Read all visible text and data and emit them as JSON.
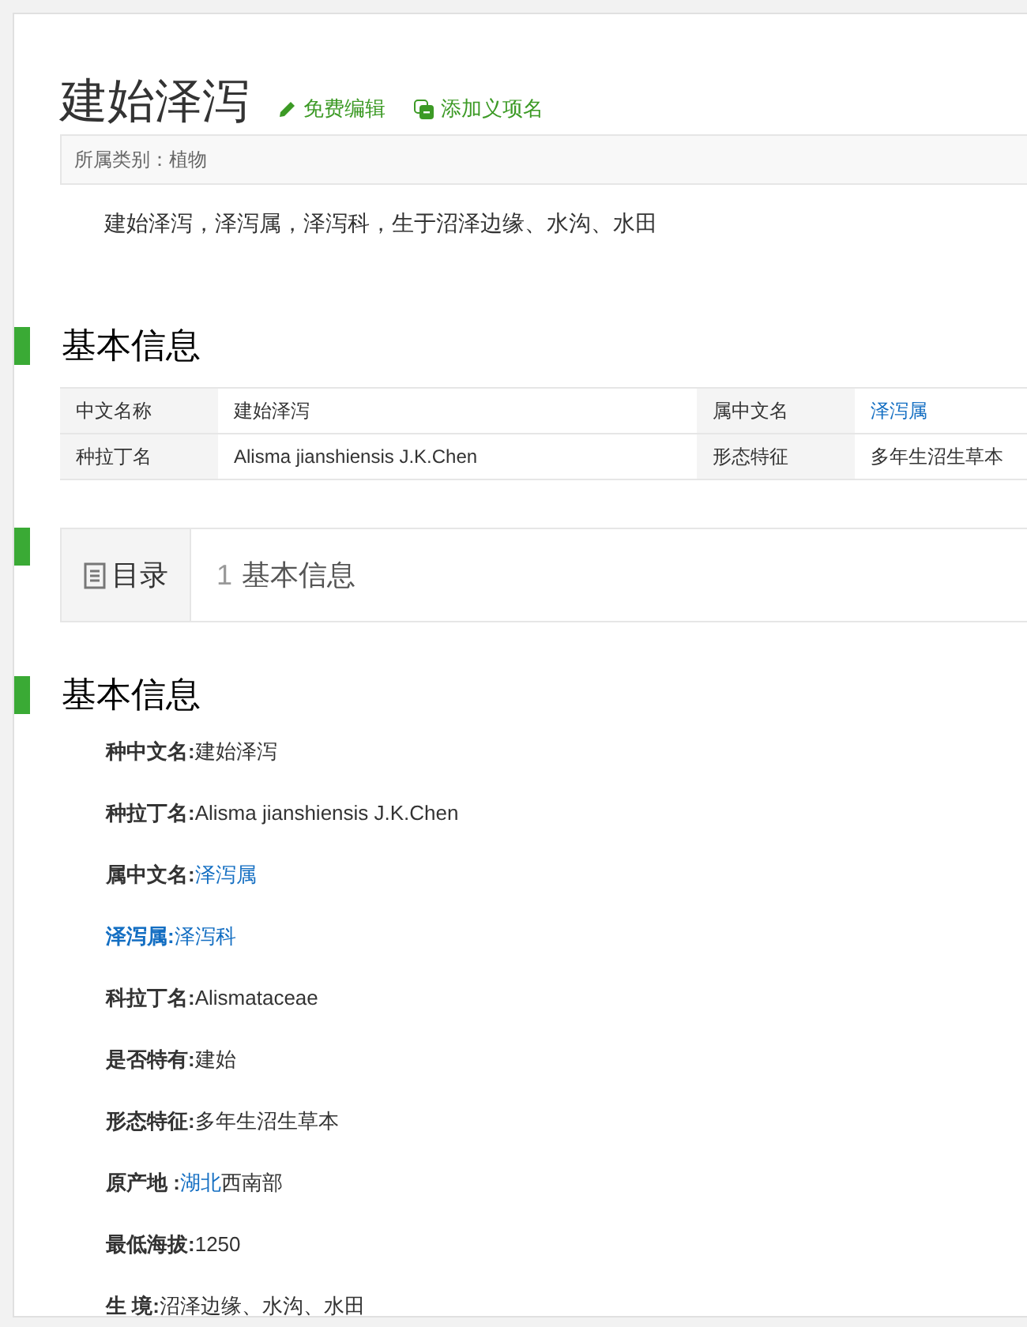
{
  "title": "建始泽泻",
  "title_actions": [
    {
      "kind": "edit",
      "label": "免费编辑"
    },
    {
      "kind": "add",
      "label": "添加义项名"
    }
  ],
  "category": "所属类别：植物",
  "summary": "建始泽泻，泽泻属，泽泻科，生于沼泽边缘、水沟、水田",
  "info_heading": "基本信息",
  "info_table": [
    {
      "cells": [
        {
          "label": "中文名称",
          "value": "建始泽泻",
          "link": false
        },
        {
          "label": "属中文名",
          "value": "泽泻属",
          "link": true
        }
      ]
    },
    {
      "cells": [
        {
          "label": "种拉丁名",
          "value": "Alisma jianshiensis J.K.Chen",
          "link": false
        },
        {
          "label": "形态特征",
          "value": "多年生沼生草本",
          "link": false
        }
      ]
    }
  ],
  "toc": {
    "title": "目录",
    "items": [
      {
        "number": "1",
        "label": "基本信息"
      }
    ]
  },
  "section_heading": "基本信息",
  "facts": [
    [
      {
        "text": "种中文名:",
        "bold": true,
        "link": false
      },
      {
        "text": "建始泽泻",
        "bold": false,
        "link": false
      }
    ],
    [
      {
        "text": "种拉丁名:",
        "bold": true,
        "link": false
      },
      {
        "text": "Alisma jianshiensis J.K.Chen",
        "bold": false,
        "link": false
      }
    ],
    [
      {
        "text": "属中文名:",
        "bold": true,
        "link": false
      },
      {
        "text": "泽泻属",
        "bold": false,
        "link": true
      }
    ],
    [
      {
        "text": "泽泻属:",
        "bold": true,
        "link": true
      },
      {
        "text": "泽泻科",
        "bold": false,
        "link": true
      }
    ],
    [
      {
        "text": "科拉丁名:",
        "bold": true,
        "link": false
      },
      {
        "text": "Alismataceae",
        "bold": false,
        "link": false
      }
    ],
    [
      {
        "text": "是否特有:",
        "bold": true,
        "link": false
      },
      {
        "text": "建始",
        "bold": false,
        "link": false
      }
    ],
    [
      {
        "text": "形态特征:",
        "bold": true,
        "link": false
      },
      {
        "text": "多年生沼生草本",
        "bold": false,
        "link": false
      }
    ],
    [
      {
        "text": "原产地 :",
        "bold": true,
        "link": false
      },
      {
        "text": "湖北",
        "bold": false,
        "link": true
      },
      {
        "text": "西南部",
        "bold": false,
        "link": false
      }
    ],
    [
      {
        "text": "最低海拔:",
        "bold": true,
        "link": false
      },
      {
        "text": "1250",
        "bold": false,
        "link": false
      }
    ],
    [
      {
        "text": "生 境:",
        "bold": true,
        "link": false
      },
      {
        "text": "沼泽边缘、水沟、水田",
        "bold": false,
        "link": false
      }
    ]
  ]
}
